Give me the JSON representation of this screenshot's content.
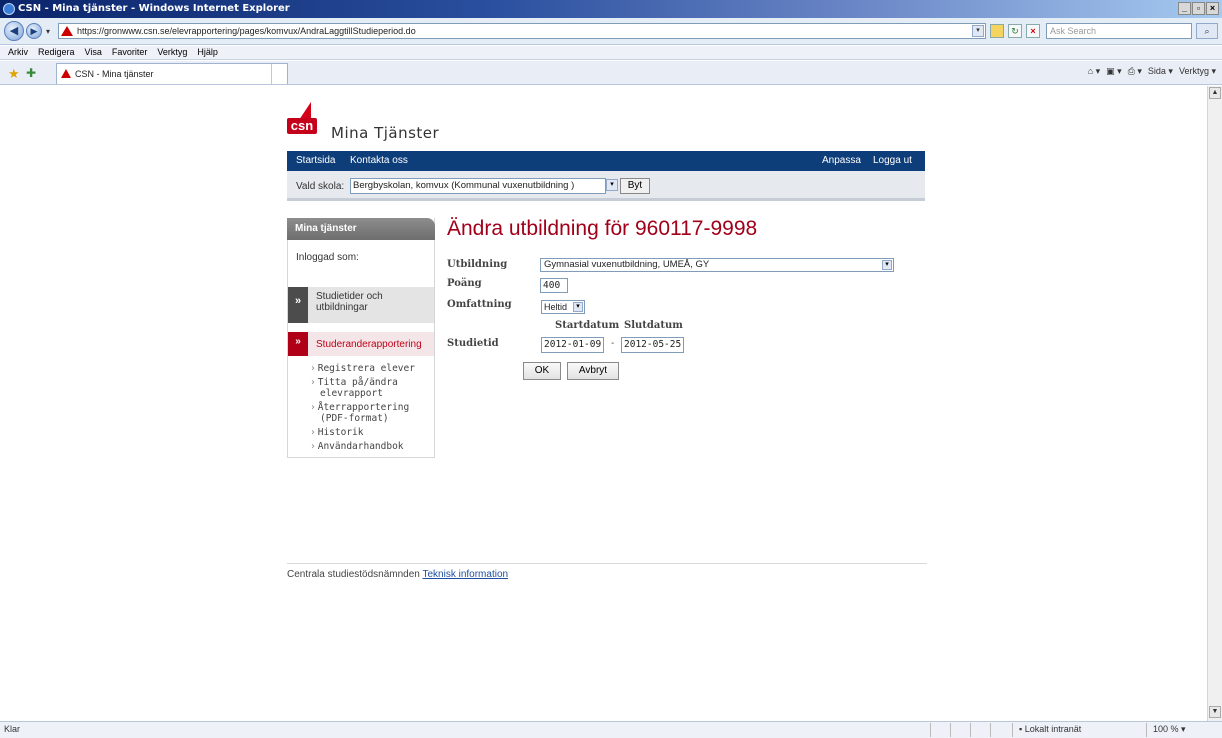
{
  "browser": {
    "window_title": "CSN - Mina tjänster - Windows Internet Explorer",
    "url": "https://gronwww.csn.se/elevrapportering/pages/komvux/AndraLaggtillStudieperiod.do",
    "search_placeholder": "Ask Search",
    "menu": [
      "Arkiv",
      "Redigera",
      "Visa",
      "Favoriter",
      "Verktyg",
      "Hjälp"
    ],
    "tab_title": "CSN - Mina tjänster",
    "commands": [
      "Sida ▾",
      "Verktyg ▾"
    ],
    "status_text": "Klar",
    "zone": "Lokalt intranät",
    "zoom": "100 %"
  },
  "site": {
    "brand": "Mina Tjänster",
    "logo_text": "csn",
    "nav": {
      "left": [
        "Startsida",
        "Kontakta oss"
      ],
      "right": [
        "Anpassa",
        "Logga ut"
      ]
    },
    "school_label": "Vald skola:",
    "school_value": "Bergbyskolan, komvux (Kommunal vuxenutbildning )",
    "school_button": "Byt"
  },
  "sidebar": {
    "title": "Mina tjänster",
    "logged_in": "Inloggad som:",
    "sections": [
      {
        "label_line1": "Studietider och",
        "label_line2": "utbildningar"
      },
      {
        "label": "Studeranderapportering"
      }
    ],
    "subitems": [
      {
        "line1": "Registrera elever",
        "line2": ""
      },
      {
        "line1": "Titta på/ändra",
        "line2": "elevrapport"
      },
      {
        "line1": "Återrapportering",
        "line2": "(PDF-format)"
      },
      {
        "line1": "Historik",
        "line2": ""
      },
      {
        "line1": "Användarhandbok",
        "line2": ""
      }
    ]
  },
  "form": {
    "heading": "Ändra utbildning för 960117-9998",
    "utbildning_label": "Utbildning",
    "utbildning_value": "Gymnasial vuxenutbildning, UMEÅ, GY",
    "poang_label": "Poäng",
    "poang_value": "400",
    "omfattning_label": "Omfattning",
    "omfattning_value": "Heltid",
    "startdatum_label": "Startdatum",
    "slutdatum_label": "Slutdatum",
    "studietid_label": "Studietid",
    "start_value": "2012-01-09",
    "dash": "-",
    "end_value": "2012-05-25",
    "ok_label": "OK",
    "cancel_label": "Avbryt"
  },
  "footer": {
    "org": "Centrala studiestödsnämnden",
    "link": "Teknisk information"
  }
}
